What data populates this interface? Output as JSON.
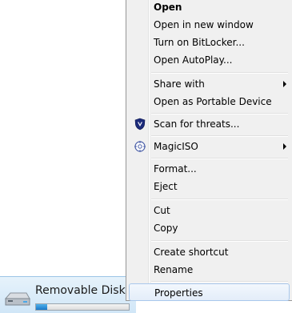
{
  "explorer_item": {
    "label": "Removable Disk",
    "capacity_used_fraction": 0.12
  },
  "context_menu": {
    "items": [
      {
        "label": "Open",
        "bold": true
      },
      {
        "label": "Open in new window"
      },
      {
        "label": "Turn on BitLocker..."
      },
      {
        "label": "Open AutoPlay..."
      },
      {
        "label": "Share with",
        "submenu": true
      },
      {
        "label": "Open as Portable Device"
      },
      {
        "label": "Scan for threats...",
        "icon": "shield-icon"
      },
      {
        "label": "MagicISO",
        "icon": "magiciso-icon",
        "submenu": true
      },
      {
        "label": "Format..."
      },
      {
        "label": "Eject"
      },
      {
        "label": "Cut"
      },
      {
        "label": "Copy"
      },
      {
        "label": "Create shortcut"
      },
      {
        "label": "Rename"
      },
      {
        "label": "Properties",
        "highlighted": true
      }
    ]
  },
  "colors": {
    "menu_background": "#f0f0f0",
    "highlight_border": "#a9c8ec",
    "capacity_fill": "#1a78c8"
  }
}
